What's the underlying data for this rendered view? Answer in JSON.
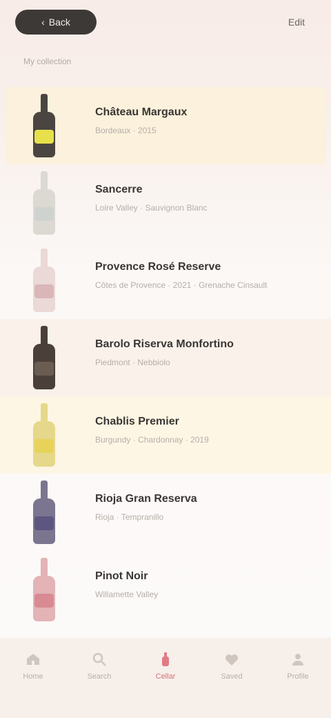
{
  "header": {
    "back_label": "Back",
    "action_label": "Edit",
    "subtitle": "My collection"
  },
  "rows": [
    {
      "title": "Château Margaux",
      "subtitle": "Bordeaux · 2015",
      "bottle_color": "#4a4540",
      "label_color": "#e8e04a",
      "highlight": "gold"
    },
    {
      "title": "Sancerre",
      "subtitle": "Loire Valley · Sauvignon Blanc",
      "bottle_color": "#dcd8d2",
      "label_color": "#cfd3cf",
      "highlight": "none"
    },
    {
      "title": "Provence Rosé Reserve",
      "subtitle": "Côtes de Provence · 2021 · Grenache Cinsault",
      "bottle_color": "#ead9d6",
      "label_color": "#d9b6b8",
      "highlight": "none"
    },
    {
      "title": "Barolo Riserva Monfortino",
      "subtitle": "Piedmont · Nebbiolo",
      "bottle_color": "#4b4039",
      "label_color": "#6b5d52",
      "highlight": "cream"
    },
    {
      "title": "Chablis Premier",
      "subtitle": "Burgundy · Chardonnay · 2019",
      "bottle_color": "#e5d88a",
      "label_color": "#e8d35a",
      "highlight": "yellow"
    },
    {
      "title": "Rioja Gran Reserva",
      "subtitle": "Rioja · Tempranillo",
      "bottle_color": "#7b7590",
      "label_color": "#5d5680",
      "highlight": "none"
    },
    {
      "title": "Pinot Noir",
      "subtitle": "Willamette Valley",
      "bottle_color": "#e3b3b6",
      "label_color": "#d98a92",
      "highlight": "none"
    }
  ],
  "nav": [
    {
      "label": "Home",
      "icon": "home-icon",
      "active": false
    },
    {
      "label": "Search",
      "icon": "search-icon",
      "active": false
    },
    {
      "label": "Cellar",
      "icon": "bottle-icon",
      "active": true
    },
    {
      "label": "Saved",
      "icon": "heart-icon",
      "active": false
    },
    {
      "label": "Profile",
      "icon": "profile-icon",
      "active": false
    }
  ],
  "colors": {
    "accent": "#d9707a",
    "header_pill": "#3d3936",
    "highlight_gold": "#fbf1dc"
  }
}
